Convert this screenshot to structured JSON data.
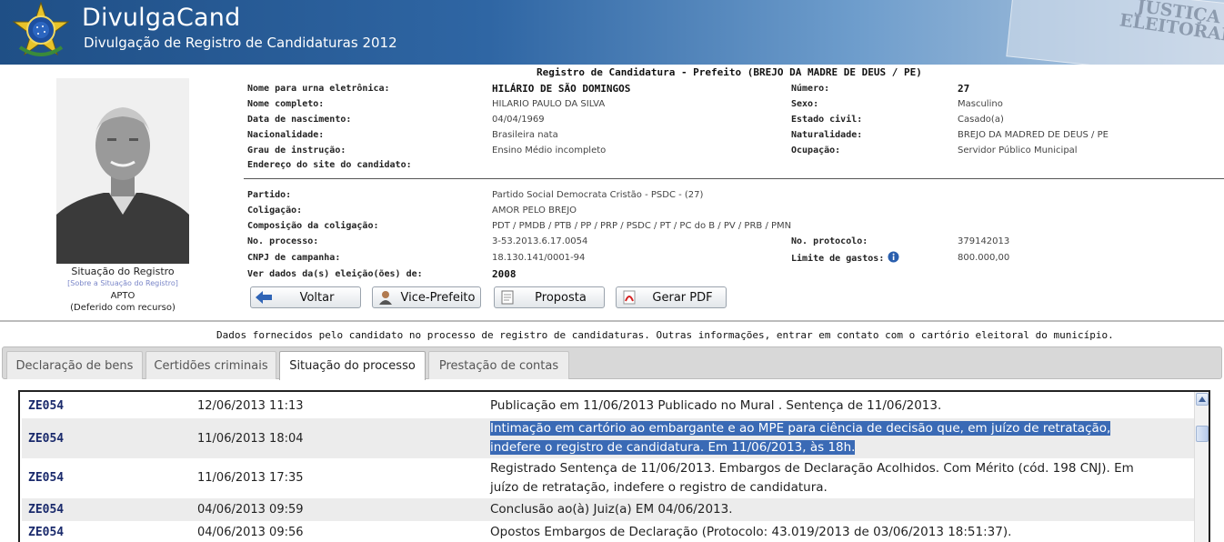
{
  "header": {
    "app_title": "DivulgaCand",
    "app_subtitle": "Divulgação de Registro de Candidaturas 2012",
    "je_text_line1": "JUSTIÇA",
    "je_text_line2": "ELEITORAL"
  },
  "record": {
    "title": "Registro de Candidatura - Prefeito (BREJO DA MADRE DE DEUS / PE)",
    "left_fields": [
      {
        "label": "Nome para urna eletrônica:",
        "value": "HILÁRIO DE SÃO DOMINGOS"
      },
      {
        "label": "Nome completo:",
        "value": "HILARIO PAULO DA SILVA"
      },
      {
        "label": "Data de nascimento:",
        "value": "04/04/1969"
      },
      {
        "label": "Nacionalidade:",
        "value": "Brasileira nata"
      },
      {
        "label": "Grau de instrução:",
        "value": "Ensino Médio incompleto"
      },
      {
        "label": "Endereço do site do candidato:",
        "value": ""
      }
    ],
    "right_fields": [
      {
        "label": "Número:",
        "value": "27"
      },
      {
        "label": "Sexo:",
        "value": "Masculino"
      },
      {
        "label": "Estado civil:",
        "value": "Casado(a)"
      },
      {
        "label": "Naturalidade:",
        "value": "BREJO DA MADRED DE DEUS / PE"
      },
      {
        "label": "Ocupação:",
        "value": "Servidor Público Municipal"
      }
    ],
    "party_fields": [
      {
        "label": "Partido:",
        "value": "Partido Social Democrata Cristão -  PSDC - (27)"
      },
      {
        "label": "Coligação:",
        "value": "AMOR PELO BREJO"
      },
      {
        "label": "Composição da coligação:",
        "value": "PDT / PMDB / PTB / PP / PRP / PSDC / PT / PC do B / PV / PRB / PMN"
      },
      {
        "label": "No. processo:",
        "value": "3-53.2013.6.17.0054"
      },
      {
        "label": "CNPJ de campanha:",
        "value": "18.130.141/0001-94"
      },
      {
        "label": "Ver dados da(s) eleição(ões) de:",
        "value": "2008"
      }
    ],
    "protocol": {
      "label": "No. protocolo:",
      "value": "379142013"
    },
    "spending": {
      "label": "Limite de gastos:",
      "value": "800.000,00"
    }
  },
  "status": {
    "heading": "Situação do Registro",
    "link": "[Sobre a Situação do Registro]",
    "value": "APTO",
    "detail": "(Deferido com recurso)"
  },
  "buttons": {
    "voltar": "Voltar",
    "vice": "Vice-Prefeito",
    "proposta": "Proposta",
    "pdf": "Gerar PDF"
  },
  "info_note": "Dados fornecidos pelo candidato no processo de registro de candidaturas.  Outras informações, entrar em contato com o cartório eleitoral do município.",
  "tabs": [
    {
      "label": "Declaração de bens"
    },
    {
      "label": "Certidões criminais"
    },
    {
      "label": "Situação do processo"
    },
    {
      "label": "Prestação de contas"
    }
  ],
  "active_tab": "Situação do processo",
  "process_rows": [
    {
      "code": "ZE054",
      "datetime": "12/06/2013 11:13",
      "desc": "Publicação em 11/06/2013 Publicado no Mural . Sentença de 11/06/2013."
    },
    {
      "code": "ZE054",
      "datetime": "11/06/2013 18:04",
      "desc_line1": "Intimação em cartório ao embargante e ao MPE para ciência de decisão que, em juízo de retratação,",
      "desc_line2": "indefere o registro de candidatura. Em 11/06/2013, às 18h."
    },
    {
      "code": "ZE054",
      "datetime": "11/06/2013 17:35",
      "desc_line1": "Registrado Sentença de 11/06/2013. Embargos de Declaração Acolhidos. Com Mérito (cód. 198 CNJ). Em",
      "desc_line2": "juízo de retratação, indefere o registro de candidatura."
    },
    {
      "code": "ZE054",
      "datetime": "04/06/2013 09:59",
      "desc": "Conclusão ao(à) Juiz(a) EM 04/06/2013."
    },
    {
      "code": "ZE054",
      "datetime": "04/06/2013 09:56",
      "desc": "Opostos Embargos de Declaração (Protocolo: 43.019/2013 de 03/06/2013 18:51:37)."
    }
  ]
}
